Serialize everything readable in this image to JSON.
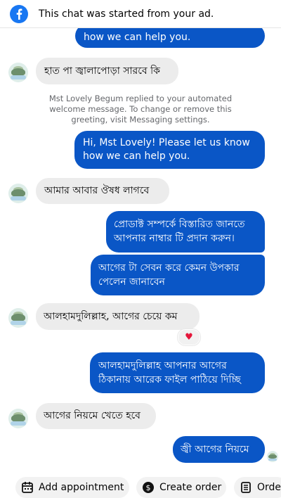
{
  "banner": {
    "icon": "facebook-icon",
    "text": "This chat was started from your ad."
  },
  "messages": [
    {
      "direction": "out",
      "text": "how we can help you."
    },
    {
      "direction": "in",
      "text": "হাত পা জ্বালাপোড়া সারবে কি"
    },
    {
      "direction": "system",
      "text": "Mst Lovely Begum replied to your automated welcome message. To change or remove this greeting, visit Messaging settings."
    },
    {
      "direction": "out",
      "line1": "Hi, Mst Lovely! Please let us know",
      "line2": "how we can help you."
    },
    {
      "direction": "in",
      "text": "আমার আবার ঔষধ লাগবে"
    },
    {
      "direction": "out",
      "line1": "প্রোডাক্ট সম্পর্কে বিস্তারিত জানতে",
      "line2": "আপনার নাম্বার টি প্রদান করুন।"
    },
    {
      "direction": "out",
      "line1": "আগের টা সেবন করে কেমন উপকার",
      "line2": "পেলেন জানাবেন"
    },
    {
      "direction": "in",
      "text": "আলহামদুলিল্লাহ, আগের চেয়ে কম"
    },
    {
      "direction": "out",
      "line1": "আলহামদুলিল্লাহ আপনার আগের",
      "line2": "ঠিকানায় আরেক ফাইল পাঠিয়ে দিচ্ছি"
    },
    {
      "direction": "in",
      "text": "আগের নিয়মে খেতে হবে"
    },
    {
      "direction": "out",
      "text": "জ্বী আগের নিয়মে"
    }
  ],
  "reaction": {
    "symbol": "♥",
    "icon": "heart-icon"
  },
  "actions": [
    {
      "label": "Add appointment",
      "icon": "calendar-icon"
    },
    {
      "label": "Create order",
      "icon": "dollar-icon"
    },
    {
      "label": "Orde",
      "icon": "orders-icon"
    }
  ],
  "colors": {
    "outgoing_bubble": "#0a56c6",
    "incoming_bubble": "#ececec",
    "facebook_blue": "#1877f2"
  }
}
